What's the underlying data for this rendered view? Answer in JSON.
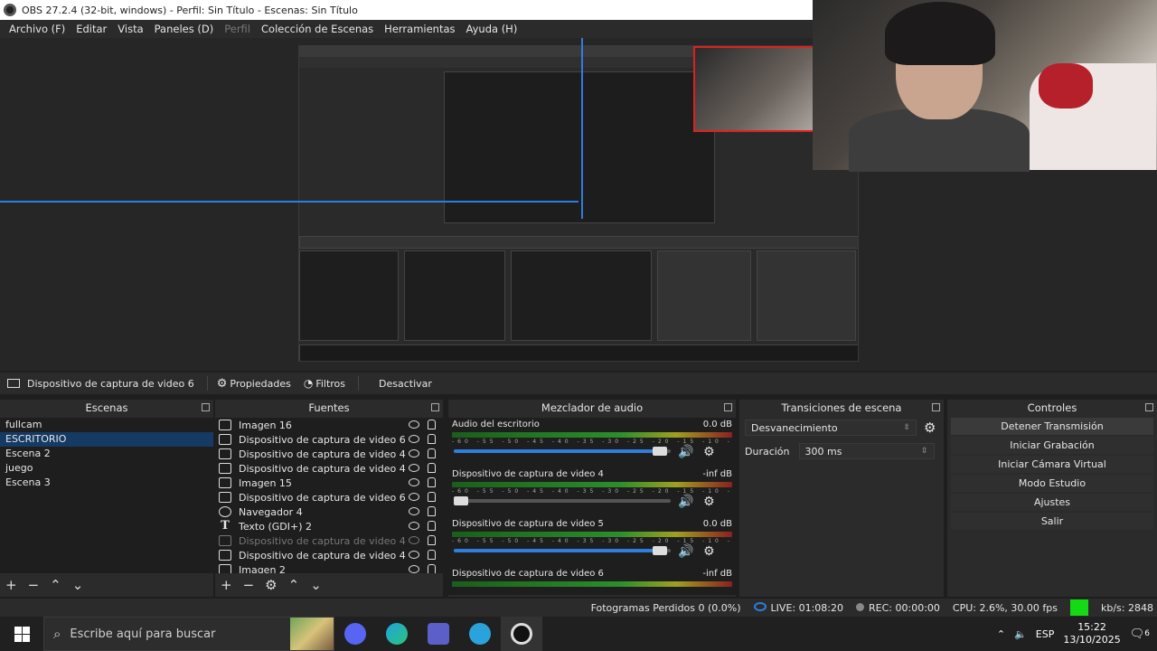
{
  "window": {
    "title": "OBS 27.2.4 (32-bit, windows) - Perfil: Sin Título - Escenas: Sin Título"
  },
  "menu": [
    "Archivo (F)",
    "Editar",
    "Vista",
    "Paneles (D)",
    "Perfil",
    "Colección de Escenas",
    "Herramientas",
    "Ayuda (H)"
  ],
  "context": {
    "source_name": "Dispositivo de captura de video 6",
    "properties": "Propiedades",
    "filters": "Filtros",
    "deactivate": "Desactivar"
  },
  "scenes": {
    "title": "Escenas",
    "items": [
      "fullcam",
      "ESCRITORIO",
      "Escena 2",
      "juego",
      "Escena 3"
    ],
    "selected": "ESCRITORIO"
  },
  "sources": {
    "title": "Fuentes",
    "items": [
      {
        "label": "Imagen 16",
        "icon": "image-icon",
        "visible": true
      },
      {
        "label": "Dispositivo de captura de video 6",
        "icon": "camera-icon",
        "visible": true
      },
      {
        "label": "Dispositivo de captura de video 4",
        "icon": "camera-icon",
        "visible": true
      },
      {
        "label": "Dispositivo de captura de video 4",
        "icon": "camera-icon",
        "visible": true
      },
      {
        "label": "Imagen 15",
        "icon": "image-icon",
        "visible": true
      },
      {
        "label": "Dispositivo de captura de video 6",
        "icon": "camera-icon",
        "visible": true
      },
      {
        "label": "Navegador 4",
        "icon": "globe-icon",
        "visible": true
      },
      {
        "label": "Texto (GDI+) 2",
        "icon": "text-icon",
        "visible": true
      },
      {
        "label": "Dispositivo de captura de video 4",
        "icon": "camera-icon",
        "visible": false
      },
      {
        "label": "Dispositivo de captura de video 4",
        "icon": "camera-icon",
        "visible": true
      },
      {
        "label": "Imagen 2",
        "icon": "image-icon",
        "visible": true
      }
    ]
  },
  "mixer": {
    "title": "Mezclador de audio",
    "tracks": [
      {
        "name": "Audio del escritorio",
        "db": "0.0 dB",
        "volume": 0.95
      },
      {
        "name": "Dispositivo de captura de video 4",
        "db": "-inf dB",
        "volume": 0.0
      },
      {
        "name": "Dispositivo de captura de video 5",
        "db": "0.0 dB",
        "volume": 0.95
      },
      {
        "name": "Dispositivo de captura de video 6",
        "db": "-inf dB",
        "volume": 0.0
      }
    ],
    "scale": "-60 -55 -50 -45 -40 -35 -30 -25 -20 -15 -10 -5 0"
  },
  "transitions": {
    "title": "Transiciones de escena",
    "selected": "Desvanecimiento",
    "duration_label": "Duración",
    "duration_value": "300 ms"
  },
  "controls": {
    "title": "Controles",
    "buttons": [
      "Detener Transmisión",
      "Iniciar Grabación",
      "Iniciar Cámara Virtual",
      "Modo Estudio",
      "Ajustes",
      "Salir"
    ]
  },
  "status": {
    "dropped": "Fotogramas Perdidos 0 (0.0%)",
    "live": "LIVE: 01:08:20",
    "rec": "REC: 00:00:00",
    "cpu": "CPU: 2.6%, 30.00 fps",
    "kbs": "kb/s: 2848",
    "health_color": "#14d914"
  },
  "taskbar": {
    "search_placeholder": "Escribe aquí para buscar",
    "lang": "ESP",
    "time": "15:22",
    "date": "13/10/2025",
    "notifications": "6"
  }
}
